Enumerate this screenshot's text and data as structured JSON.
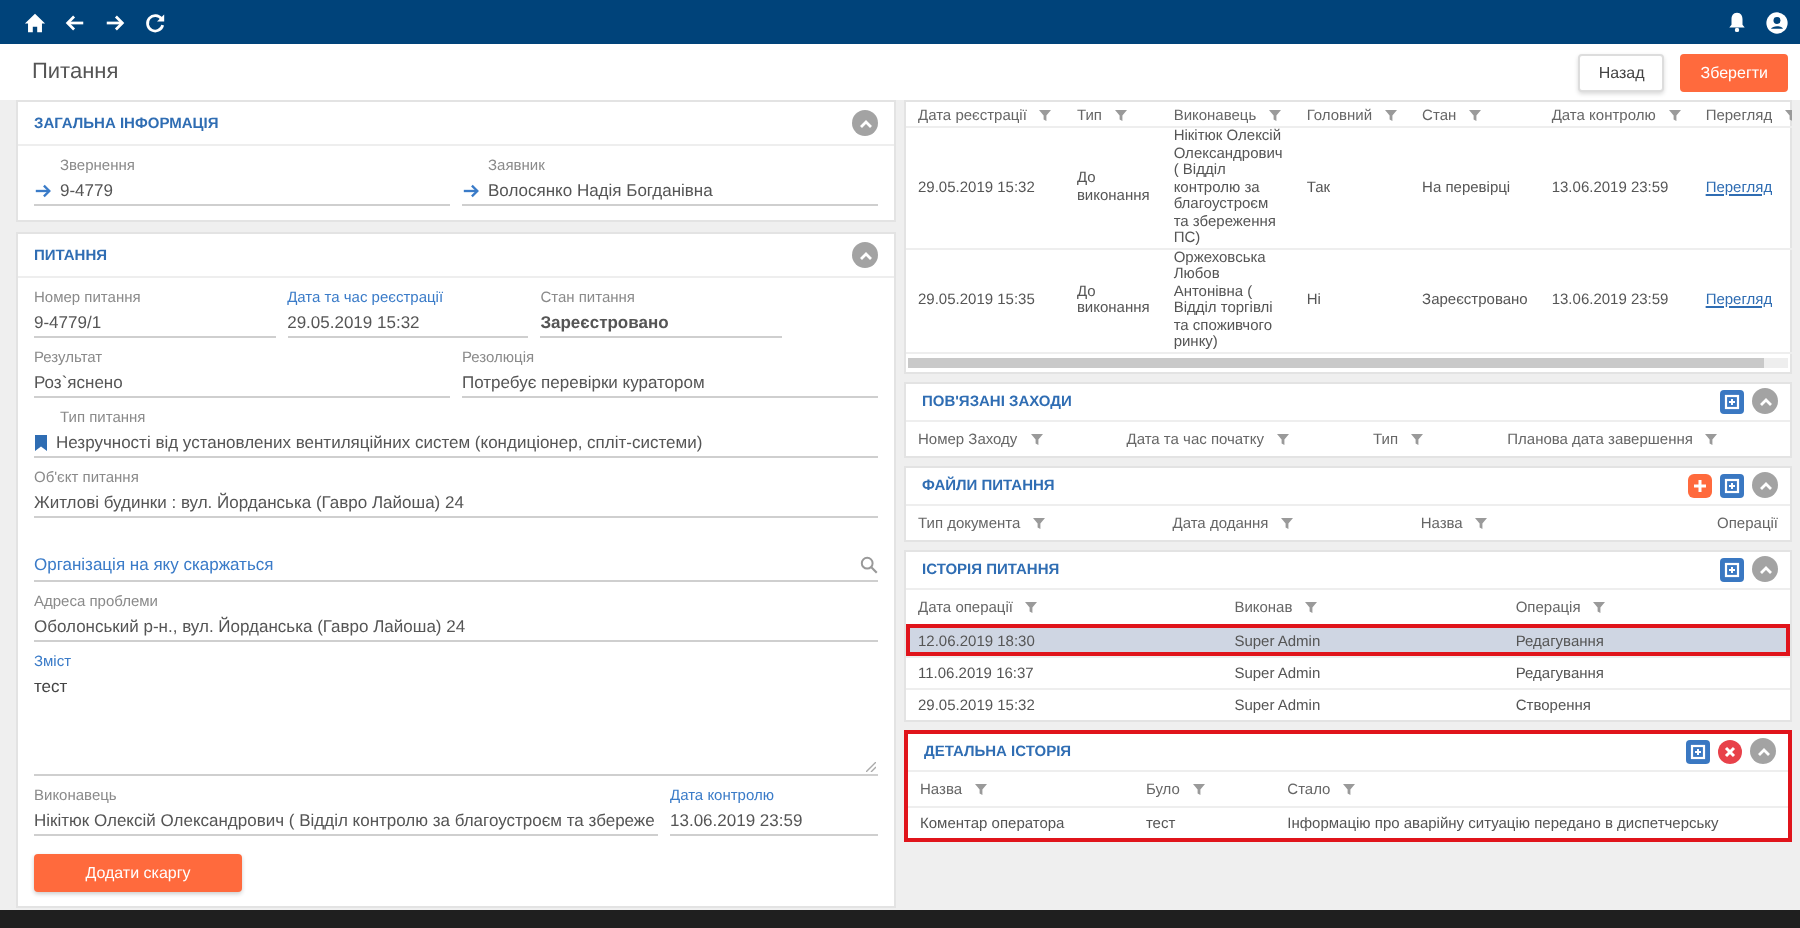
{
  "page": {
    "title": "Питання"
  },
  "actions": [
    {
      "label": "Назад",
      "kind": "secondary"
    },
    {
      "label": "Зберегти",
      "kind": "primary"
    }
  ],
  "form_sections": [
    {
      "title": "ЗАГАЛЬНА ІНФОРМАЦІЯ",
      "expanded": true,
      "rows": [
        [
          {
            "kind": "link",
            "label": "Звернення",
            "value": "9-4779",
            "required": false
          },
          {
            "kind": "link",
            "label": "Заявник",
            "value": "Волосянко Надія Богданівна",
            "required": false
          }
        ]
      ]
    },
    {
      "title": "ПИТАННЯ",
      "expanded": true,
      "rows": [
        [
          {
            "kind": "text",
            "label": "Номер питання",
            "value": "9-4779/1",
            "required": false
          },
          {
            "kind": "text",
            "label": "Дата та час реєстрації",
            "value": "29.05.2019 15:32",
            "required": true
          },
          {
            "kind": "status",
            "label": "Стан питання",
            "value": "Зареєстровано",
            "required": false
          }
        ],
        [
          {
            "kind": "text",
            "label": "Результат",
            "value": "Роз`яснено",
            "required": false
          },
          {
            "kind": "text",
            "label": "Резолюція",
            "value": "Потребує перевірки куратором",
            "required": false
          }
        ],
        [
          {
            "kind": "tag",
            "label": "Тип питання",
            "value": "Незручності від установлених вентиляційних систем (кондиціонер, спліт-системи)",
            "required": false
          }
        ],
        [
          {
            "kind": "text",
            "label": "Об'єкт питання",
            "value": "Житлові будинки : вул. Йорданська (Гавро Лайоша) 24",
            "required": false
          }
        ],
        [
          {
            "kind": "search",
            "placeholder": "Організація на яку скаржаться"
          }
        ],
        [
          {
            "kind": "text",
            "label": "Адреса проблеми",
            "value": "Оболонський р-н., вул. Йорданська (Гавро Лайоша) 24",
            "required": false
          }
        ],
        [
          {
            "kind": "textarea",
            "label": "Зміст",
            "value": "тест",
            "required": true
          }
        ],
        [
          {
            "kind": "text",
            "label": "Виконавець",
            "value": "Нікітюк Олексій Олександрович ( Відділ контролю за благоустроєм та збереже",
            "required": false
          },
          {
            "kind": "date",
            "label": "Дата контролю",
            "value": "13.06.2019 23:59",
            "required": true
          }
        ]
      ],
      "button": {
        "label": "Додати скаргу"
      }
    }
  ],
  "requests": {
    "columns": [
      {
        "label": "Дата реєстрації",
        "kind": "filter"
      },
      {
        "label": "Тип",
        "kind": "filter"
      },
      {
        "label": "Виконавець",
        "kind": "filter"
      },
      {
        "label": "Головний",
        "kind": "filter"
      },
      {
        "label": "Стан",
        "kind": "filter"
      },
      {
        "label": "Дата контролю",
        "kind": "filter"
      },
      {
        "label": "Перегляд",
        "kind": "link"
      }
    ],
    "rows": [
      [
        "29.05.2019 15:32",
        "До виконання",
        "Нікітюк Олексій Олександрович ( Відділ контролю за благоустроєм та збереження ПС)",
        "Так",
        "На перевірці",
        "13.06.2019 23:59",
        "Перегляд"
      ],
      [
        "29.05.2019 15:35",
        "До виконання",
        "Оржеховська Любов Антонівна ( Відділ торгівлі та споживчого ринку)",
        "Ні",
        "Зареєстровано",
        "13.06.2019 23:59",
        "Перегляд"
      ]
    ]
  },
  "table_sections": [
    {
      "title": "ПОВ'ЯЗАНІ ЗАХОДИ",
      "expanded": true,
      "highlighted": false,
      "tools": [
        {
          "kind": "export"
        }
      ],
      "columns": [
        {
          "label": "Номер Заходу",
          "kind": "filter"
        },
        {
          "label": "Дата та час початку",
          "kind": "filter"
        },
        {
          "label": "Тип",
          "kind": "filter"
        },
        {
          "label": "Планова дата завершення",
          "kind": "filter"
        }
      ]
    },
    {
      "title": "ФАЙЛИ ПИТАННЯ",
      "expanded": true,
      "highlighted": false,
      "tools": [
        {
          "kind": "add"
        },
        {
          "kind": "export"
        }
      ],
      "columns": [
        {
          "label": "Тип документа",
          "kind": "filter"
        },
        {
          "label": "Дата додання",
          "kind": "filter"
        },
        {
          "label": "Назва",
          "kind": "filter"
        },
        {
          "label": "Операції",
          "kind": "actions"
        }
      ]
    },
    {
      "title": "ІСТОРІЯ ПИТАННЯ",
      "expanded": true,
      "highlighted": false,
      "tools": [
        {
          "kind": "export"
        }
      ],
      "columns": [
        {
          "label": "Дата операції",
          "kind": "filter"
        },
        {
          "label": "Виконав",
          "kind": "filter"
        },
        {
          "label": "Операція",
          "kind": "filter"
        }
      ],
      "rows": [
        {
          "cells": [
            "12.06.2019 18:30",
            "Super Admin",
            "Редагування"
          ],
          "selected": true,
          "highlighted": true
        },
        {
          "cells": [
            "11.06.2019 16:37",
            "Super Admin",
            "Редагування"
          ],
          "selected": false,
          "highlighted": false
        },
        {
          "cells": [
            "29.05.2019 15:32",
            "Super Admin",
            "Створення"
          ],
          "selected": false,
          "highlighted": false
        }
      ]
    },
    {
      "title": "ДЕТАЛЬНА ІСТОРІЯ",
      "expanded": true,
      "highlighted": true,
      "tools": [
        {
          "kind": "export"
        },
        {
          "kind": "delete"
        }
      ],
      "columns": [
        {
          "label": "Назва",
          "kind": "filter"
        },
        {
          "label": "Було",
          "kind": "filter"
        },
        {
          "label": "Стало",
          "kind": "filter"
        }
      ],
      "rows": [
        {
          "cells": [
            "Коментар оператора",
            "тест",
            "Інформацію про аварійну ситуацію передано в диспетчерську"
          ],
          "selected": false,
          "highlighted": false
        }
      ]
    }
  ]
}
